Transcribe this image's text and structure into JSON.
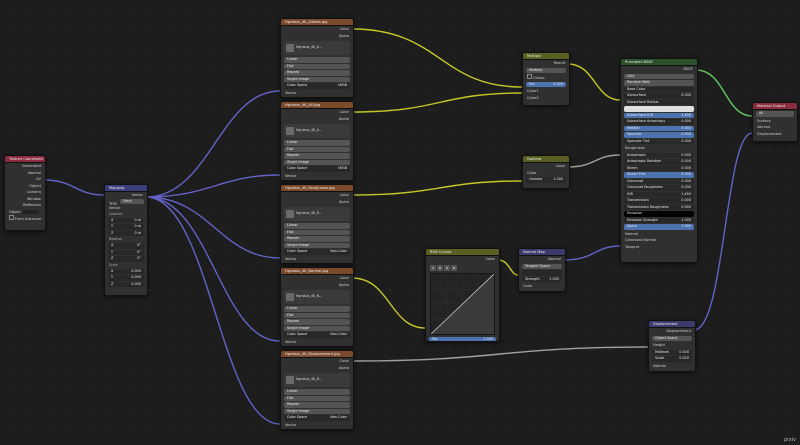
{
  "nodes": {
    "texcoord": {
      "title": "Texture Coordinate",
      "outputs": [
        "Generated",
        "Normal",
        "UV",
        "Object",
        "Camera",
        "Window",
        "Reflection"
      ],
      "object_label": "Object",
      "from_instancer": "From Instancer"
    },
    "mapping": {
      "title": "Mapping",
      "out": "Vector",
      "type_label": "Type",
      "type_value": "Point",
      "vector": "Vector",
      "location": "Location",
      "rotation": "Rotation",
      "scale": "Scale",
      "loc": [
        [
          "X",
          "0 m"
        ],
        [
          "Y",
          "0 m"
        ],
        [
          "Z",
          "0 m"
        ]
      ],
      "rot": [
        [
          "X",
          "0°"
        ],
        [
          "Y",
          "0°"
        ],
        [
          "Z",
          "0°"
        ]
      ],
      "scl": [
        [
          "X",
          "0.000"
        ],
        [
          "Y",
          "0.000"
        ],
        [
          "Z",
          "0.000"
        ]
      ]
    },
    "tex1": {
      "title": "Hgrabus_4K_Albedo.jpg",
      "file": "Hgrabus_4K_A...",
      "colorspace_val": "sRGB"
    },
    "tex2": {
      "title": "Hgrabus_4K_AO.jpg",
      "file": "Hgrabus_4K_A...",
      "colorspace_val": "sRGB"
    },
    "tex3": {
      "title": "Hgrabus_4K_Roughness.jpg",
      "file": "Hgrabus_4K_R...",
      "colorspace_val": "Non-Color"
    },
    "tex4": {
      "title": "Hgrabus_4K_Normal.jpg",
      "file": "Hgrabus_4K_N...",
      "colorspace_val": "Non-Color"
    },
    "tex5": {
      "title": "Hgrabus_4K_Displacement.jpg",
      "file": "Hgrabus_4K_D...",
      "colorspace_val": "Non-Color"
    },
    "tex_common": {
      "color": "Color",
      "alpha": "Alpha",
      "interp": "Linear",
      "proj": "Flat",
      "ext": "Repeat",
      "src": "Single Image",
      "cs": "Color Space",
      "vector": "Vector"
    },
    "multiply": {
      "title": "Multiply",
      "result": "Result",
      "mode": "Multiply",
      "clamp": "Clamp",
      "fac_label": "Fac",
      "fac_value": "0.500",
      "a": "Color1",
      "b": "Color2"
    },
    "invert": {
      "title": "Gamma",
      "color": "Color",
      "in_color": "Color",
      "gamma_label": "Gamma",
      "gamma_value": "1.000"
    },
    "rgbcurves": {
      "title": "RGB Curves",
      "color": "Color",
      "btns": [
        "C",
        "R",
        "G",
        "B"
      ],
      "fac_label": "Fac",
      "fac_value": "1.000",
      "in_color": "Color"
    },
    "normalmap": {
      "title": "Normal Map",
      "normal": "Normal",
      "space": "Tangent Space",
      "uv": "",
      "strength_label": "Strength",
      "strength_value": "1.000",
      "color": "Color"
    },
    "displacement": {
      "title": "Displacement",
      "out": "Displacement",
      "space": "Object Space",
      "height": "Height",
      "mid_label": "Midlevel",
      "mid_value": "0.500",
      "scale_label": "Scale",
      "scale_value": "0.020",
      "normal": "Normal"
    },
    "bsdf": {
      "title": "Principled BSDF",
      "out": "BSDF",
      "dist": "GGX",
      "sss": "Random Walk",
      "rows": [
        [
          "Base Color",
          ""
        ],
        [
          "Subsurface",
          "0.000"
        ],
        [
          "Subsurface Radius",
          ""
        ],
        [
          "Subsurface Co...",
          ""
        ],
        [
          "Subsurface IOR",
          "1.400"
        ],
        [
          "Subsurface Anisotropy",
          "0.000"
        ],
        [
          "Metallic",
          "0.000"
        ],
        [
          "Specular",
          "0.500"
        ],
        [
          "Specular Tint",
          "0.000"
        ],
        [
          "Roughness",
          ""
        ],
        [
          "Anisotropic",
          "0.000"
        ],
        [
          "Anisotropic Rotation",
          "0.000"
        ],
        [
          "Sheen",
          "0.000"
        ],
        [
          "Sheen Tint",
          "0.500"
        ],
        [
          "Clearcoat",
          "0.000"
        ],
        [
          "Clearcoat Roughness",
          "0.030"
        ],
        [
          "IOR",
          "1.450"
        ],
        [
          "Transmission",
          "0.000"
        ],
        [
          "Transmission Roughness",
          "0.000"
        ],
        [
          "Emission",
          ""
        ],
        [
          "Emission Strength",
          "1.000"
        ],
        [
          "Alpha",
          "1.000"
        ],
        [
          "Normal",
          ""
        ],
        [
          "Clearcoat Normal",
          ""
        ],
        [
          "Tangent",
          ""
        ]
      ]
    },
    "output": {
      "title": "Material Output",
      "target": "All",
      "surface": "Surface",
      "volume": "Volume",
      "displacement": "Displacement"
    }
  },
  "watermark": "pixiv",
  "colors": {
    "texture_header": "#7a4a2a",
    "shader_header": "#2c4f2c",
    "vector_header": "#3c3f7c",
    "color_header": "#5c5f23",
    "input_header": "#8a2b3f",
    "socket_color": "#c7c729",
    "socket_vector": "#6363c7",
    "socket_float": "#a1a1a1",
    "socket_shader": "#63c763"
  }
}
